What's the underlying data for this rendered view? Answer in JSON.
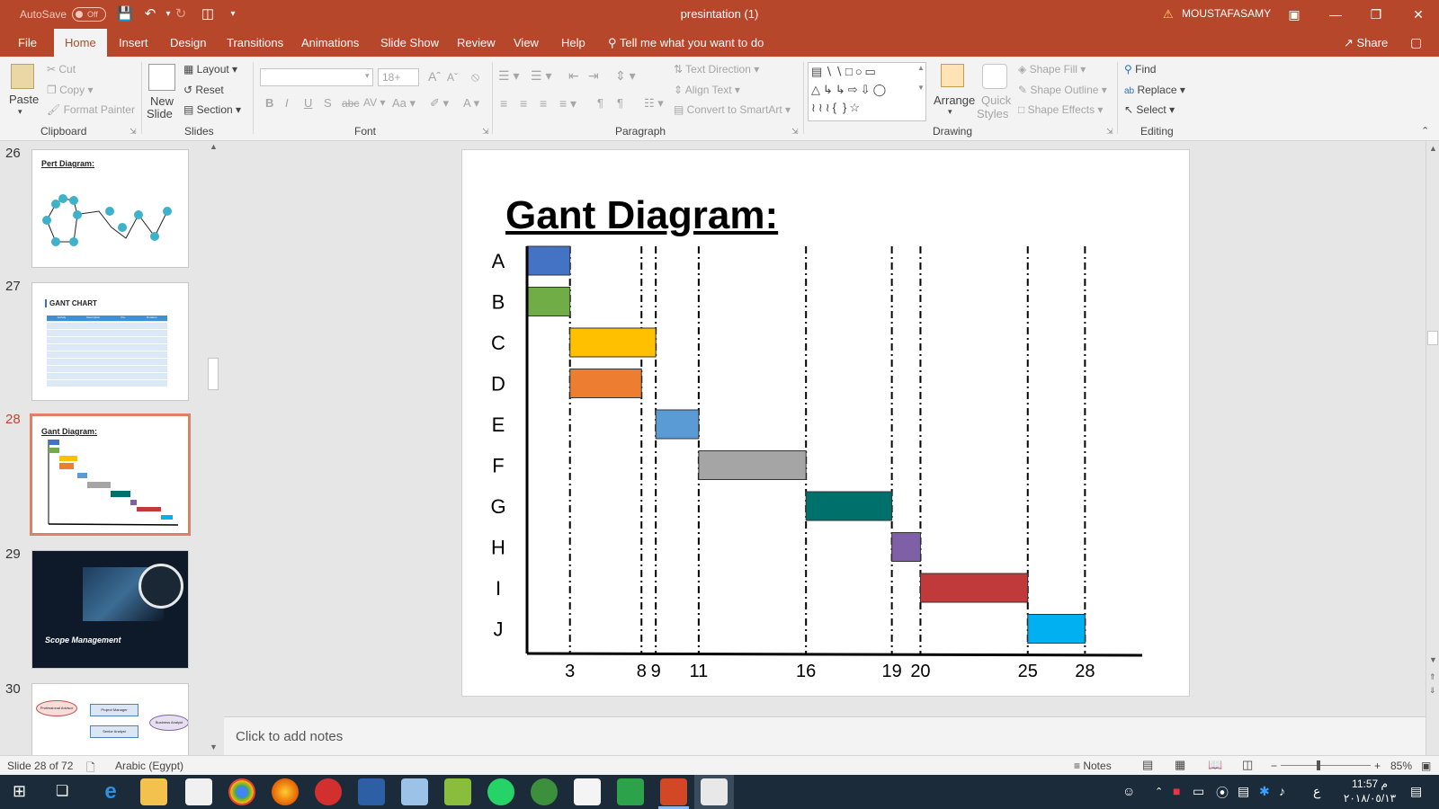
{
  "titlebar": {
    "autosave": "AutoSave",
    "autosave_state": "Off",
    "doc_title": "presintation (1)",
    "user": "MOUSTAFASAMY"
  },
  "tabs": [
    "File",
    "Home",
    "Insert",
    "Design",
    "Transitions",
    "Animations",
    "Slide Show",
    "Review",
    "View",
    "Help"
  ],
  "tell_me": "Tell me what you want to do",
  "share": "Share",
  "ribbon": {
    "paste": "Paste",
    "cut": "Cut",
    "copy": "Copy",
    "format_painter": "Format Painter",
    "clipboard": "Clipboard",
    "new_slide_1": "New",
    "new_slide_2": "Slide",
    "layout": "Layout",
    "reset": "Reset",
    "section": "Section",
    "slides": "Slides",
    "font_size": "18+",
    "font": "Font",
    "text_direction": "Text Direction",
    "align_text": "Align Text",
    "convert_smartart": "Convert to SmartArt",
    "paragraph": "Paragraph",
    "arrange": "Arrange",
    "quick_styles_1": "Quick",
    "quick_styles_2": "Styles",
    "shape_fill": "Shape Fill",
    "shape_outline": "Shape Outline",
    "shape_effects": "Shape Effects",
    "drawing": "Drawing",
    "find": "Find",
    "replace": "Replace",
    "select": "Select",
    "editing": "Editing"
  },
  "thumbnails": [
    {
      "num": "26",
      "title": "Pert Diagram:"
    },
    {
      "num": "27",
      "title": "GANT CHART"
    },
    {
      "num": "28",
      "title": "Gant Diagram:"
    },
    {
      "num": "29",
      "title": "Scope Management"
    },
    {
      "num": "30",
      "title": ""
    }
  ],
  "thumb27_headers": [
    "Activity",
    "Description",
    "Pre.",
    "Duration"
  ],
  "thumb30_labels": [
    "Professional Advisor",
    "Project Manager",
    "Business Analyst",
    "Senior Analyst"
  ],
  "notes_placeholder": "Click to add notes",
  "status": {
    "slide": "Slide 28 of 72",
    "language": "Arabic (Egypt)",
    "notes": "Notes",
    "zoom": "85%"
  },
  "clock": {
    "time": "11:57 م",
    "date": "٢٠١٨/٠٥/١٣"
  },
  "tray_lang": "ع",
  "chart_data": {
    "type": "gantt",
    "title": "Gant Diagram:",
    "tasks": [
      {
        "name": "A",
        "start": 0,
        "end": 3,
        "color": "#4472c4"
      },
      {
        "name": "B",
        "start": 0,
        "end": 3,
        "color": "#70ad47"
      },
      {
        "name": "C",
        "start": 3,
        "end": 9,
        "color": "#ffc000"
      },
      {
        "name": "D",
        "start": 3,
        "end": 8,
        "color": "#ed7d31"
      },
      {
        "name": "E",
        "start": 9,
        "end": 12,
        "color": "#5b9bd5"
      },
      {
        "name": "F",
        "start": 12,
        "end": 19.5,
        "color": "#a5a5a5"
      },
      {
        "name": "G",
        "start": 19.5,
        "end": 25.5,
        "color": "#00706b"
      },
      {
        "name": "H",
        "start": 25.5,
        "end": 27.5,
        "color": "#7f5fa6"
      },
      {
        "name": "I",
        "start": 27.5,
        "end": 35,
        "color": "#c0393b"
      },
      {
        "name": "J",
        "start": 35,
        "end": 39,
        "color": "#00b0f0"
      }
    ],
    "tick_labels": [
      "3",
      "8",
      "9",
      "11",
      "16",
      "19",
      "20",
      "25",
      "28"
    ],
    "tick_positions": [
      3,
      8,
      9,
      12,
      19.5,
      25.5,
      27.5,
      35,
      39
    ],
    "xlim": [
      0,
      43
    ]
  }
}
